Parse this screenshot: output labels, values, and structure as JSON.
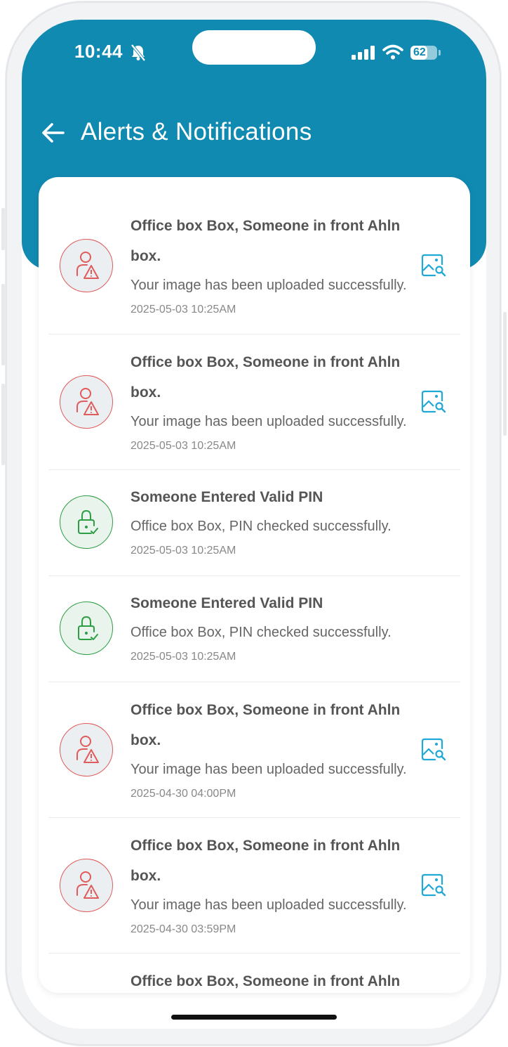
{
  "status_bar": {
    "time": "10:44",
    "battery": "62",
    "battery_level": 0.62
  },
  "header": {
    "title": "Alerts & Notifications"
  },
  "notifications": [
    {
      "type": "person-alert",
      "title": "Office box  Box, Someone in front Ahln box.",
      "message": "Your image has been uploaded successfully.",
      "date": "2025-05-03 10:25AM"
    },
    {
      "type": "person-alert",
      "title": "Office box  Box, Someone in front Ahln box.",
      "message": "Your image has been uploaded successfully.",
      "date": "2025-05-03 10:25AM"
    },
    {
      "type": "pin-valid",
      "title": "Someone Entered Valid PIN",
      "message": "Office box  Box, PIN checked successfully.",
      "date": "2025-05-03 10:25AM"
    },
    {
      "type": "pin-valid",
      "title": "Someone Entered Valid PIN",
      "message": "Office box  Box, PIN checked successfully.",
      "date": "2025-05-03 10:25AM"
    },
    {
      "type": "person-alert",
      "title": "Office box  Box, Someone in front Ahln box.",
      "message": "Your image has been uploaded successfully.",
      "date": "2025-04-30 04:00PM"
    },
    {
      "type": "person-alert",
      "title": "Office box  Box, Someone in front Ahln box.",
      "message": "Your image has been uploaded successfully.",
      "date": "2025-04-30 03:59PM"
    },
    {
      "type": "person-alert",
      "title": "Office box  Box, Someone in front Ahln",
      "message": "",
      "date": ""
    }
  ],
  "colors": {
    "header": "#118ab2",
    "alert_red": "#e05b5b",
    "success_green": "#2e9e44",
    "image_icon": "#1fa8d8"
  }
}
